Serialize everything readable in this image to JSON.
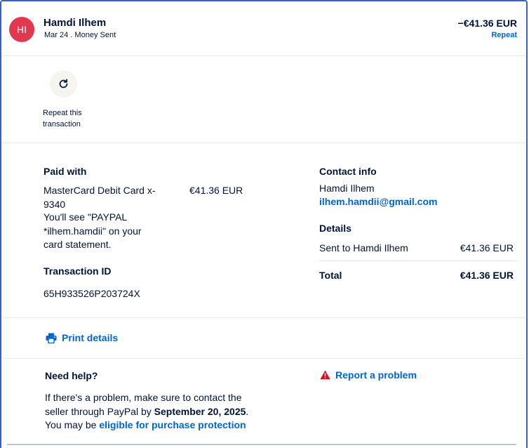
{
  "header": {
    "avatar_initials": "HI",
    "name": "Hamdi Ilhem",
    "date": "Mar 24",
    "separator": " . ",
    "type": "Money Sent",
    "amount": "−€41.36 EUR",
    "repeat_link": "Repeat"
  },
  "repeat_action": {
    "icon": "refresh-icon",
    "label": "Repeat this transaction"
  },
  "paid_with": {
    "title": "Paid with",
    "card": "MasterCard Debit Card x-9340",
    "amount": "€41.36 EUR",
    "statement_note": "You'll see \"PAYPAL *ilhem.hamdii\" on your card statement."
  },
  "transaction": {
    "title": "Transaction ID",
    "id": "65H933526P203724X"
  },
  "contact": {
    "title": "Contact info",
    "name": "Hamdi Ilhem",
    "email": "ilhem.hamdii@gmail.com"
  },
  "details": {
    "title": "Details",
    "sent_to_label": "Sent to Hamdi Ilhem",
    "sent_to_amount": "€41.36 EUR",
    "total_label": "Total",
    "total_amount": "€41.36 EUR"
  },
  "print": {
    "icon": "printer-icon",
    "label": "Print details"
  },
  "help": {
    "title": "Need help?",
    "text_before": "If there's a problem, make sure to contact the seller through PayPal by ",
    "deadline": "September 20, 2025",
    "text_middle": ". You may be ",
    "protection_link": "eligible for purchase protection"
  },
  "report": {
    "icon": "warning-icon",
    "label": "Report a problem"
  },
  "colors": {
    "avatar": "#e0384e",
    "link": "#0065d1",
    "text": "#001435",
    "warning": "#d50c22",
    "frame_border": "#3b5ec9"
  }
}
